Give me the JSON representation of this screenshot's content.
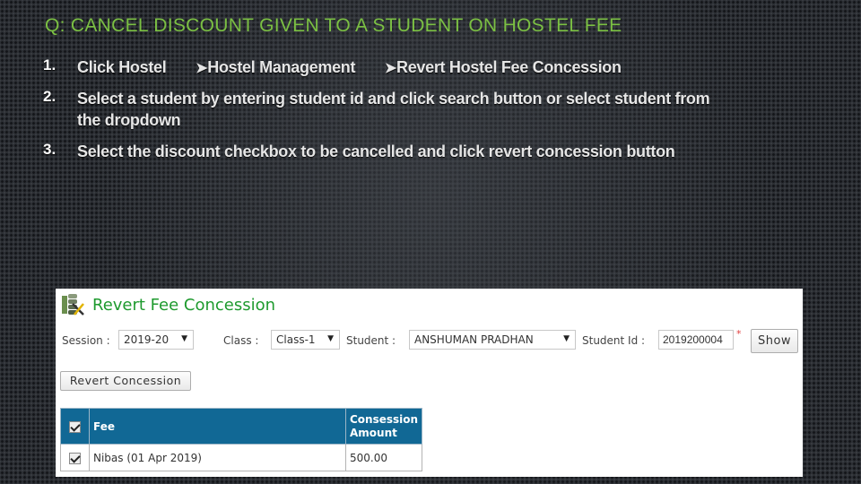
{
  "slide": {
    "title": "Q: Cancel discount given to a student on hostel fee",
    "steps": [
      {
        "number": "1.",
        "breadcrumb": [
          "Click Hostel",
          "Hostel Management",
          "Revert Hostel Fee Concession"
        ],
        "arrow_icon": "arrow-right"
      },
      {
        "number": "2.",
        "text": "Select a student by entering student id and click search button or select student from the dropdown"
      },
      {
        "number": "3.",
        "text": "Select the discount checkbox to be cancelled and click revert concession button"
      }
    ]
  },
  "screenshot": {
    "page_title": "Revert Fee Concession",
    "page_icon": "fee-tools-icon",
    "filters": {
      "session_label": "Session :",
      "session_value": "2019-20",
      "class_label": "Class :",
      "class_value": "Class-1",
      "student_label": "Student :",
      "student_value": "ANSHUMAN PRADHAN",
      "student_id_label": "Student Id :",
      "student_id_value": "2019200004",
      "required_mark": "*",
      "show_button": "Show"
    },
    "revert_button": "Revert Concession",
    "accent_color": "#116895",
    "title_color": "#1e9a2e",
    "table": {
      "headers": [
        "",
        "Fee",
        "Consession Amount"
      ],
      "header_amount_line1": "Consession",
      "header_amount_line2": "Amount",
      "select_all_checked": true,
      "rows": [
        {
          "checked": true,
          "fee": "Nibas (01 Apr 2019)",
          "amount": "500.00"
        }
      ]
    }
  }
}
